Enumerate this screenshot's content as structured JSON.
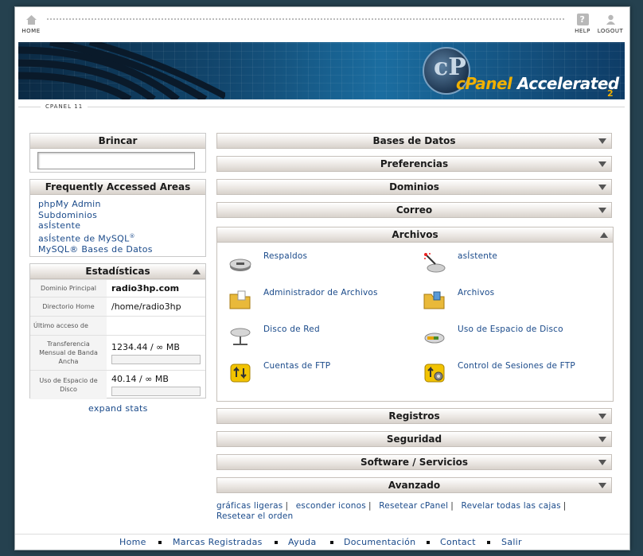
{
  "topbar": {
    "home_label": "HOME",
    "help_label": "HELP",
    "logout_label": "LOGOUT"
  },
  "banner": {
    "logo_mark": "cP",
    "logo_brand": "cPanel",
    "logo_word": "Accelerated",
    "logo_version": "2"
  },
  "version_label": "CPANEL 11",
  "sidebar": {
    "brincar_title": "Brincar",
    "search_value": "",
    "faa_title": "Frequently Accessed Areas",
    "faa_links": [
      "phpMy Admin",
      "Subdominios",
      "asÍstente",
      "asÍstente de MySQL",
      "MySQL® Bases de Datos"
    ],
    "faa_reg": "®",
    "stats_title": "Estadísticas",
    "stats": [
      {
        "key": "Dominio Principal",
        "value": "radio3hp.com"
      },
      {
        "key": "Directorio Home",
        "value": "/home/radio3hp"
      },
      {
        "key": "Último acceso de",
        "value": ""
      },
      {
        "key": "Transferencia Mensual de Banda Ancha",
        "value": "1234.44 / ∞ MB",
        "usage": 0
      },
      {
        "key": "Uso de Espacio de Disco",
        "value": "40.14 / ∞ MB",
        "usage": 0
      }
    ],
    "expand_label": "expand stats"
  },
  "sections": {
    "bases": "Bases de Datos",
    "preferencias": "Preferencias",
    "dominios": "Dominios",
    "correo": "Correo",
    "archivos": "Archivos",
    "registros": "Registros",
    "seguridad": "Seguridad",
    "software": "Software / Servicios",
    "avanzado": "Avanzado"
  },
  "archivos_items": [
    {
      "label": "Respaldos",
      "icon": "backup-drive-icon"
    },
    {
      "label": "asÍstente",
      "icon": "wizard-icon"
    },
    {
      "label": "Administrador de Archivos",
      "icon": "file-manager-folder-icon"
    },
    {
      "label": "Archivos",
      "icon": "folder-icon"
    },
    {
      "label": "Disco de Red",
      "icon": "network-disk-icon"
    },
    {
      "label": "Uso de Espacio de Disco",
      "icon": "disk-usage-icon"
    },
    {
      "label": "Cuentas de FTP",
      "icon": "ftp-accounts-icon"
    },
    {
      "label": "Control de Sesiones de FTP",
      "icon": "ftp-session-icon"
    }
  ],
  "bottom_links": [
    "gráficas ligeras",
    "esconder iconos",
    "Resetear cPanel",
    "Revelar todas las cajas",
    "Resetear el orden"
  ],
  "footer": [
    "Home",
    "Marcas Registradas",
    "Ayuda",
    "Documentación",
    "Contact",
    "Salir"
  ],
  "colors": {
    "link": "#1a4a8a",
    "banner": "#124870",
    "accent": "#f0b000"
  }
}
